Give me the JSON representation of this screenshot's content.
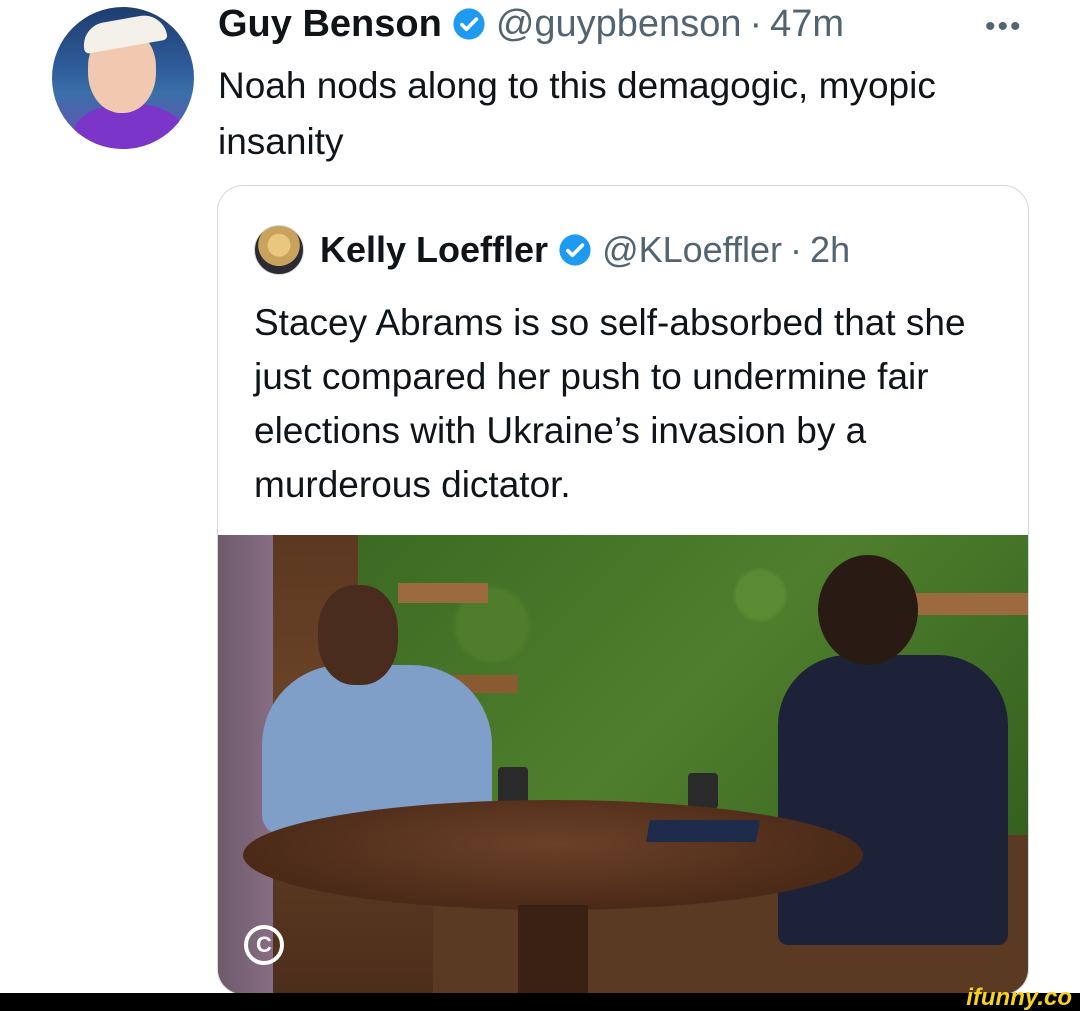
{
  "tweet": {
    "author_name": "Guy Benson",
    "handle": "@guypbenson",
    "separator": "·",
    "time": "47m",
    "more": "•••",
    "text": "Noah nods along to this demagogic, myopic insanity"
  },
  "quoted_tweet": {
    "author_name": "Kelly Loeffler",
    "handle": "@KLoeffler",
    "separator": "·",
    "time": "2h",
    "text": "Stacey Abrams is so self-absorbed that she just compared her push to undermine fair elections with Ukraine’s invasion by a murderous dictator.",
    "media_logo_text": "C"
  },
  "watermark": "ifunny.co",
  "colors": {
    "verified": "#1d9bf0",
    "secondary_text": "#536471",
    "watermark": "#f6d21f"
  }
}
